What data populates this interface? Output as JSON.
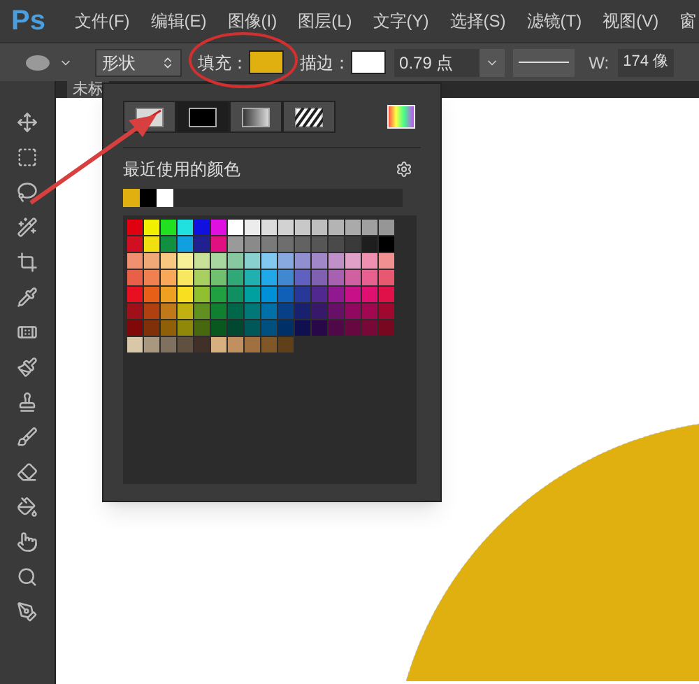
{
  "menu_bar": {
    "logo": "Ps",
    "items": [
      "文件(F)",
      "编辑(E)",
      "图像(I)",
      "图层(L)",
      "文字(Y)",
      "选择(S)",
      "滤镜(T)",
      "视图(V)",
      "窗"
    ]
  },
  "options_bar": {
    "mode": "形状",
    "color_fields": [
      {
        "label": "填充：",
        "color": "#e0b010"
      },
      {
        "label": "描边：",
        "color": "#ffffff"
      }
    ],
    "stroke_width": "0.79 点",
    "w_label": "W:",
    "w_value": "174 像"
  },
  "document_tab": {
    "title": "未标"
  },
  "fill_panel": {
    "types": [
      {
        "kind": "none",
        "selected": false
      },
      {
        "kind": "solid",
        "selected": true
      },
      {
        "kind": "gradient",
        "selected": false
      },
      {
        "kind": "pattern",
        "selected": false
      }
    ],
    "recent_title": "最近使用的颜色",
    "recent_colors": [
      {
        "color": "#e0b010"
      },
      {
        "color": "#000000"
      },
      {
        "color": "#ffffff"
      }
    ],
    "swatch_rows": [
      {
        "swatches": [
          {
            "color": "#e00010"
          },
          {
            "color": "#f0f000"
          },
          {
            "color": "#20e020"
          },
          {
            "color": "#20e0e0"
          },
          {
            "color": "#1010e0"
          },
          {
            "color": "#e010e0"
          },
          {
            "color": "#ffffff"
          },
          {
            "color": "#ececec"
          },
          {
            "color": "#dcdcdc"
          },
          {
            "color": "#d2d2d2"
          },
          {
            "color": "#c8c8c8"
          },
          {
            "color": "#bebebe"
          },
          {
            "color": "#b4b4b4"
          },
          {
            "color": "#aaaaaa"
          },
          {
            "color": "#a0a0a0"
          },
          {
            "color": "#969696"
          }
        ]
      },
      {
        "swatches": [
          {
            "color": "#d01020"
          },
          {
            "color": "#f0e010"
          },
          {
            "color": "#109040"
          },
          {
            "color": "#10a0e0"
          },
          {
            "color": "#202090"
          },
          {
            "color": "#e01080"
          },
          {
            "color": "#9a9a9a"
          },
          {
            "color": "#8a8a8a"
          },
          {
            "color": "#7a7a7a"
          },
          {
            "color": "#6e6e6e"
          },
          {
            "color": "#626262"
          },
          {
            "color": "#565656"
          },
          {
            "color": "#4a4a4a"
          },
          {
            "color": "#3a3a3a"
          },
          {
            "color": "#1e1e1e"
          },
          {
            "color": "#000000"
          }
        ]
      },
      {
        "swatches": [
          {
            "color": "#f09070"
          },
          {
            "color": "#f0a878"
          },
          {
            "color": "#f8c880"
          },
          {
            "color": "#f8f098"
          },
          {
            "color": "#c8e098"
          },
          {
            "color": "#a8d8a0"
          },
          {
            "color": "#88c8a0"
          },
          {
            "color": "#88d0d0"
          },
          {
            "color": "#80c8f0"
          },
          {
            "color": "#88a8e0"
          },
          {
            "color": "#9090d0"
          },
          {
            "color": "#a088c8"
          },
          {
            "color": "#c090c8"
          },
          {
            "color": "#e0a0c8"
          },
          {
            "color": "#f090b0"
          },
          {
            "color": "#f09090"
          }
        ]
      },
      {
        "swatches": [
          {
            "color": "#e86048"
          },
          {
            "color": "#f08050"
          },
          {
            "color": "#f8a858"
          },
          {
            "color": "#f8e860"
          },
          {
            "color": "#a8d060"
          },
          {
            "color": "#70c070"
          },
          {
            "color": "#30a878"
          },
          {
            "color": "#20b0b0"
          },
          {
            "color": "#20a8e8"
          },
          {
            "color": "#4088d0"
          },
          {
            "color": "#6060c0"
          },
          {
            "color": "#8060b0"
          },
          {
            "color": "#a860b0"
          },
          {
            "color": "#d060a0"
          },
          {
            "color": "#e86090"
          },
          {
            "color": "#e85870"
          }
        ]
      },
      {
        "swatches": [
          {
            "color": "#e81020"
          },
          {
            "color": "#e86018"
          },
          {
            "color": "#f0a020"
          },
          {
            "color": "#f8e020"
          },
          {
            "color": "#90c030"
          },
          {
            "color": "#20a040"
          },
          {
            "color": "#109060"
          },
          {
            "color": "#00a0a0"
          },
          {
            "color": "#0090d8"
          },
          {
            "color": "#1060b8"
          },
          {
            "color": "#283898"
          },
          {
            "color": "#502890"
          },
          {
            "color": "#901890"
          },
          {
            "color": "#c81088"
          },
          {
            "color": "#e01070"
          },
          {
            "color": "#e01048"
          }
        ]
      },
      {
        "swatches": [
          {
            "color": "#a01018"
          },
          {
            "color": "#b04010"
          },
          {
            "color": "#c07818"
          },
          {
            "color": "#c0b010"
          },
          {
            "color": "#609020"
          },
          {
            "color": "#108030"
          },
          {
            "color": "#006848"
          },
          {
            "color": "#007878"
          },
          {
            "color": "#0070a8"
          },
          {
            "color": "#084088"
          },
          {
            "color": "#182070"
          },
          {
            "color": "#381868"
          },
          {
            "color": "#681068"
          },
          {
            "color": "#900860"
          },
          {
            "color": "#a00850"
          },
          {
            "color": "#a00830"
          }
        ]
      },
      {
        "swatches": [
          {
            "color": "#800808"
          },
          {
            "color": "#803008"
          },
          {
            "color": "#906008"
          },
          {
            "color": "#908808"
          },
          {
            "color": "#486810"
          },
          {
            "color": "#085820"
          },
          {
            "color": "#004830"
          },
          {
            "color": "#005858"
          },
          {
            "color": "#005080"
          },
          {
            "color": "#003068"
          },
          {
            "color": "#101050"
          },
          {
            "color": "#280848"
          },
          {
            "color": "#500848"
          },
          {
            "color": "#680840"
          },
          {
            "color": "#780838"
          },
          {
            "color": "#780820"
          }
        ]
      },
      {
        "swatches": [
          {
            "color": "#d8c8a8"
          },
          {
            "color": "#a89880"
          },
          {
            "color": "#807060"
          },
          {
            "color": "#605040"
          },
          {
            "color": "#403028"
          },
          {
            "color": "#d8b080"
          },
          {
            "color": "#c09060"
          },
          {
            "color": "#a07040"
          },
          {
            "color": "#805828"
          },
          {
            "color": "#604018"
          }
        ]
      }
    ]
  }
}
